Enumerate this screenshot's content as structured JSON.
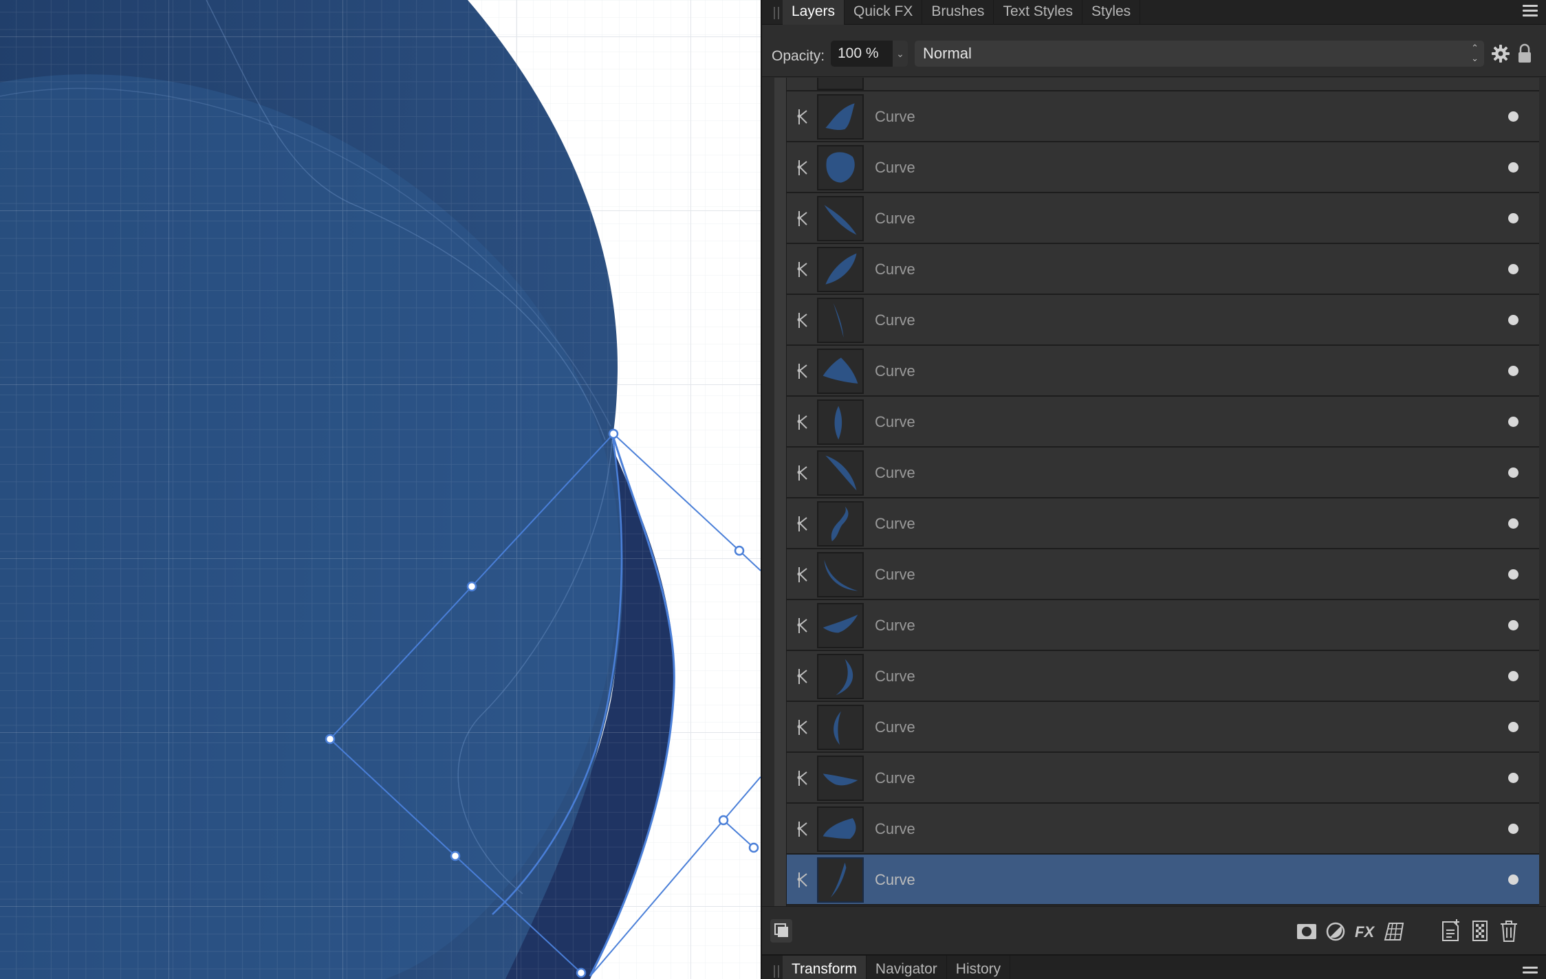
{
  "tabs_top": [
    {
      "label": "Layers",
      "active": true
    },
    {
      "label": "Quick FX",
      "active": false
    },
    {
      "label": "Brushes",
      "active": false
    },
    {
      "label": "Text Styles",
      "active": false
    },
    {
      "label": "Styles",
      "active": false
    }
  ],
  "options": {
    "opacity_label": "Opacity:",
    "opacity_value": "100 %",
    "blend_mode": "Normal"
  },
  "layers": [
    {
      "name": "Curve",
      "shape": "flag",
      "selected": false
    },
    {
      "name": "Curve",
      "shape": "blob",
      "selected": false
    },
    {
      "name": "Curve",
      "shape": "wedge-down",
      "selected": false
    },
    {
      "name": "Curve",
      "shape": "leaf-up",
      "selected": false
    },
    {
      "name": "Curve",
      "shape": "sliver",
      "selected": false
    },
    {
      "name": "Curve",
      "shape": "fan",
      "selected": false
    },
    {
      "name": "Curve",
      "shape": "lens",
      "selected": false
    },
    {
      "name": "Curve",
      "shape": "arc-right",
      "selected": false
    },
    {
      "name": "Curve",
      "shape": "s-curve",
      "selected": false
    },
    {
      "name": "Curve",
      "shape": "crescent-low",
      "selected": false
    },
    {
      "name": "Curve",
      "shape": "flat-wedge",
      "selected": false
    },
    {
      "name": "Curve",
      "shape": "crescent-right",
      "selected": false
    },
    {
      "name": "Curve",
      "shape": "crescent-left",
      "selected": false
    },
    {
      "name": "Curve",
      "shape": "dart",
      "selected": false
    },
    {
      "name": "Curve",
      "shape": "wing",
      "selected": false
    },
    {
      "name": "Curve",
      "shape": "thin-arc",
      "selected": true
    }
  ],
  "tabs_bottom": [
    {
      "label": "Transform",
      "active": true
    },
    {
      "label": "Navigator",
      "active": false
    },
    {
      "label": "History",
      "active": false
    }
  ],
  "colors": {
    "accent_selection": "#3d5a83",
    "shape_fill": "#2d5386",
    "curve_stroke": "#4a7fd8"
  }
}
